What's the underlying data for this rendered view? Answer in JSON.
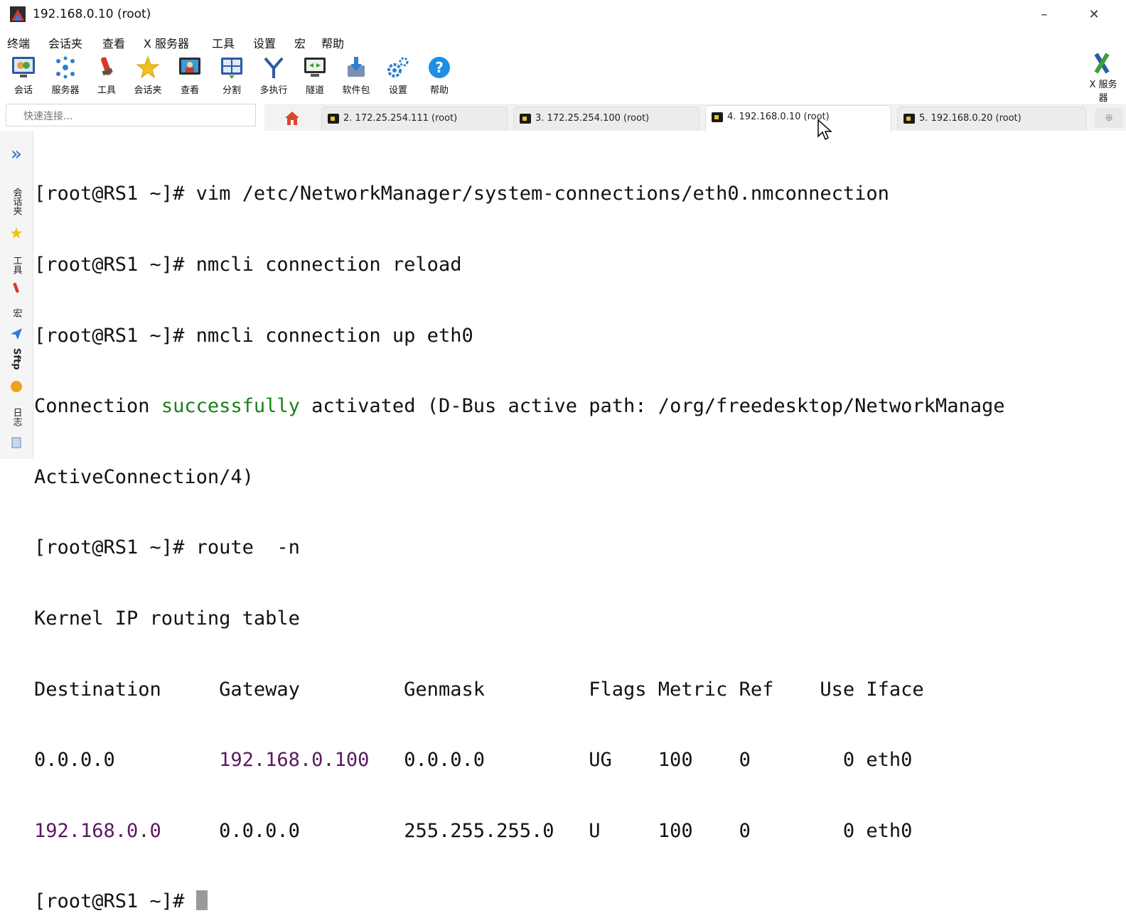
{
  "window": {
    "title": "192.168.0.10 (root)",
    "minimize": "–",
    "close": "✕"
  },
  "menu": [
    "终端",
    "会话夹",
    "查看",
    "X 服务器",
    "工具",
    "设置",
    "宏",
    "帮助"
  ],
  "toolbar": [
    {
      "label": "会话",
      "icon": "session-icon"
    },
    {
      "label": "服务器",
      "icon": "servers-icon"
    },
    {
      "label": "工具",
      "icon": "tools-icon"
    },
    {
      "label": "会话夹",
      "icon": "star-icon"
    },
    {
      "label": "查看",
      "icon": "view-icon"
    },
    {
      "label": "分割",
      "icon": "split-icon"
    },
    {
      "label": "多执行",
      "icon": "multiexec-icon"
    },
    {
      "label": "隧道",
      "icon": "tunnel-icon"
    },
    {
      "label": "软件包",
      "icon": "package-icon"
    },
    {
      "label": "设置",
      "icon": "settings-icon"
    },
    {
      "label": "帮助",
      "icon": "help-icon"
    }
  ],
  "xserver": {
    "label_line1": "X 服务",
    "label_line2": "器"
  },
  "quick_connect": {
    "placeholder": "快速连接..."
  },
  "tabs": [
    {
      "label": "2. 172.25.254.111 (root)",
      "active": false
    },
    {
      "label": "3. 172.25.254.100 (root)",
      "active": false
    },
    {
      "label": "4. 192.168.0.10 (root)",
      "active": true
    },
    {
      "label": "5. 192.168.0.20 (root)",
      "active": false
    }
  ],
  "sidebar": {
    "expand": "»",
    "sessions": "会话夹",
    "tools": "工具",
    "macros": "宏",
    "sftp": "Sftp",
    "logs": "日志"
  },
  "terminal": {
    "lines": [
      {
        "prompt": "[root@RS1 ~]# ",
        "text": "vim /etc/NetworkManager/system-connections/eth0.nmconnection"
      },
      {
        "prompt": "[root@RS1 ~]# ",
        "text": "nmcli connection reload"
      },
      {
        "prompt": "[root@RS1 ~]# ",
        "text": "nmcli connection up eth0"
      },
      {
        "pre": "Connection ",
        "green": "successfully",
        "post": " activated (D-Bus active path: /org/freedesktop/NetworkManage"
      },
      {
        "text": "ActiveConnection/4)"
      },
      {
        "prompt": "[root@RS1 ~]# ",
        "text": "route  -n"
      },
      {
        "text": "Kernel IP routing table"
      },
      {
        "text": "Destination     Gateway         Genmask         Flags Metric Ref    Use Iface"
      },
      {
        "c1": "0.0.0.0         ",
        "c1_purple": false,
        "c2": "192.168.0.100",
        "c2_purple": true,
        "rest": "   0.0.0.0         UG    100    0        0 eth0"
      },
      {
        "c1": "192.168.0.0",
        "c1_purple": true,
        "c2": "     0.0.0.0",
        "c2_purple": false,
        "rest": "         255.255.255.0   U     100    0        0 eth0"
      },
      {
        "prompt": "[root@RS1 ~]# ",
        "text": ""
      }
    ]
  }
}
